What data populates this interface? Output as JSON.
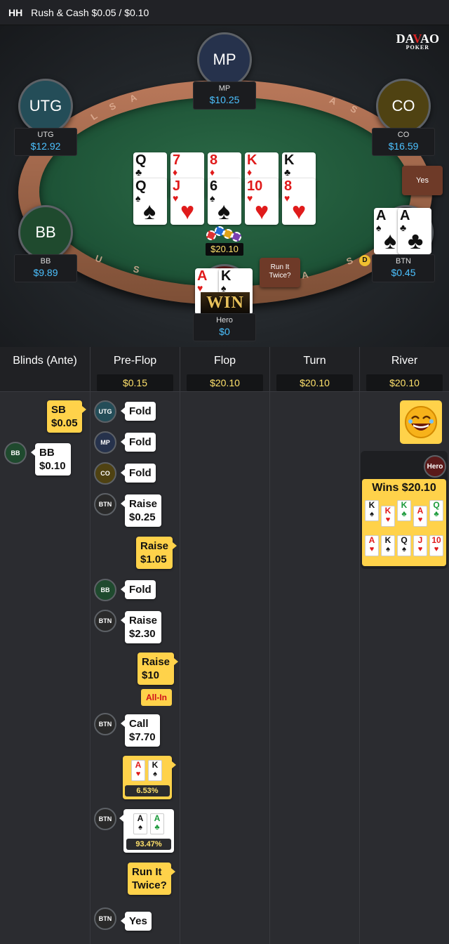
{
  "titlebar": {
    "prefix": "HH",
    "title": "Rush & Cash $0.05 / $0.10"
  },
  "logo": {
    "text_a": "DA",
    "text_v": "V",
    "text_b": "AO",
    "sub": "POKER"
  },
  "rail_letters": [
    "A",
    "S",
    "L",
    "A",
    "S",
    "U",
    "S",
    "A",
    "S"
  ],
  "seats": {
    "mp": {
      "avatar": "MP",
      "name": "MP",
      "stack": "$10.25",
      "color": "#26324c"
    },
    "utg": {
      "avatar": "UTG",
      "name": "UTG",
      "stack": "$12.92",
      "color": "#244d58"
    },
    "co": {
      "avatar": "CO",
      "name": "CO",
      "stack": "$16.59",
      "color": "#4f4212"
    },
    "bb": {
      "avatar": "BB",
      "name": "BB",
      "stack": "$9.89",
      "color": "#1f4a2e"
    },
    "btn": {
      "name": "BTN",
      "stack": "$0.45"
    },
    "hero": {
      "name": "Hero",
      "stack": "$0"
    }
  },
  "board_top": [
    {
      "rank": "Q",
      "suit": "♣",
      "color": "blk"
    },
    {
      "rank": "7",
      "suit": "♦",
      "color": "red"
    },
    {
      "rank": "8",
      "suit": "♦",
      "color": "red"
    },
    {
      "rank": "K",
      "suit": "♦",
      "color": "red"
    },
    {
      "rank": "K",
      "suit": "♣",
      "color": "blk"
    }
  ],
  "board_bottom": [
    {
      "rank": "Q",
      "suit": "♠",
      "color": "blk"
    },
    {
      "rank": "J",
      "suit": "♥",
      "color": "red"
    },
    {
      "rank": "6",
      "suit": "♠",
      "color": "blk"
    },
    {
      "rank": "10",
      "suit": "♥",
      "color": "red"
    },
    {
      "rank": "8",
      "suit": "♥",
      "color": "red"
    }
  ],
  "btn_cards": [
    {
      "rank": "A",
      "suit": "♠",
      "color": "blk"
    },
    {
      "rank": "A",
      "suit": "♣",
      "color": "blk"
    }
  ],
  "hero_cards": [
    {
      "rank": "A",
      "suit": "♥",
      "color": "red"
    },
    {
      "rank": "K",
      "suit": "♠",
      "color": "blk"
    }
  ],
  "pot": "$20.10",
  "table_bubbles": {
    "yes": "Yes",
    "run_it_twice": "Run It Twice?"
  },
  "dealer_button": "D",
  "win_badge": "WIN",
  "columns": [
    {
      "title": "Blinds (Ante)",
      "pot": ""
    },
    {
      "title": "Pre-Flop",
      "pot": "$0.15"
    },
    {
      "title": "Flop",
      "pot": "$20.10"
    },
    {
      "title": "Turn",
      "pot": "$20.10"
    },
    {
      "title": "River",
      "pot": "$20.10"
    }
  ],
  "blinds": {
    "sb_l1": "SB",
    "sb_l2": "$0.05",
    "bb_badge": "BB",
    "bb_l1": "BB",
    "bb_l2": "$0.10"
  },
  "preflop": {
    "utg_badge": "UTG",
    "utg_action": "Fold",
    "mp_badge": "MP",
    "mp_action": "Fold",
    "co_badge": "CO",
    "co_action": "Fold",
    "btn_badge": "BTN",
    "btn_raise1_l1": "Raise",
    "btn_raise1_l2": "$0.25",
    "hero_raise1_l1": "Raise",
    "hero_raise1_l2": "$1.05",
    "bb_badge": "BB",
    "bb_action": "Fold",
    "btn_raise2_l1": "Raise",
    "btn_raise2_l2": "$2.30",
    "hero_raise2_l1": "Raise",
    "hero_raise2_l2": "$10",
    "all_in": "All-In",
    "btn_call_l1": "Call",
    "btn_call_l2": "$7.70",
    "hero_equity": "6.53%",
    "btn_equity": "93.47%",
    "hero_rit_l1": "Run It",
    "hero_rit_l2": "Twice?",
    "btn_yes": "Yes"
  },
  "hero_show": [
    {
      "rank": "A",
      "suit": "♥",
      "color": "red"
    },
    {
      "rank": "K",
      "suit": "♠",
      "color": "blk"
    }
  ],
  "btn_show": [
    {
      "rank": "A",
      "suit": "♠",
      "color": "blk"
    },
    {
      "rank": "A",
      "suit": "♣",
      "color": "grn"
    }
  ],
  "river": {
    "hero_badge": "Hero",
    "wins": "Wins $20.10",
    "row1": [
      {
        "rank": "K",
        "suit": "♠",
        "color": "blk"
      },
      {
        "rank": "K",
        "suit": "♥",
        "color": "red"
      },
      {
        "rank": "K",
        "suit": "♣",
        "color": "grn"
      },
      {
        "rank": "A",
        "suit": "♥",
        "color": "red"
      },
      {
        "rank": "Q",
        "suit": "♣",
        "color": "grn"
      }
    ],
    "row2": [
      {
        "rank": "A",
        "suit": "♥",
        "color": "red"
      },
      {
        "rank": "K",
        "suit": "♠",
        "color": "blk"
      },
      {
        "rank": "Q",
        "suit": "♠",
        "color": "blk"
      },
      {
        "rank": "J",
        "suit": "♥",
        "color": "red"
      },
      {
        "rank": "10",
        "suit": "♥",
        "color": "red"
      }
    ]
  }
}
